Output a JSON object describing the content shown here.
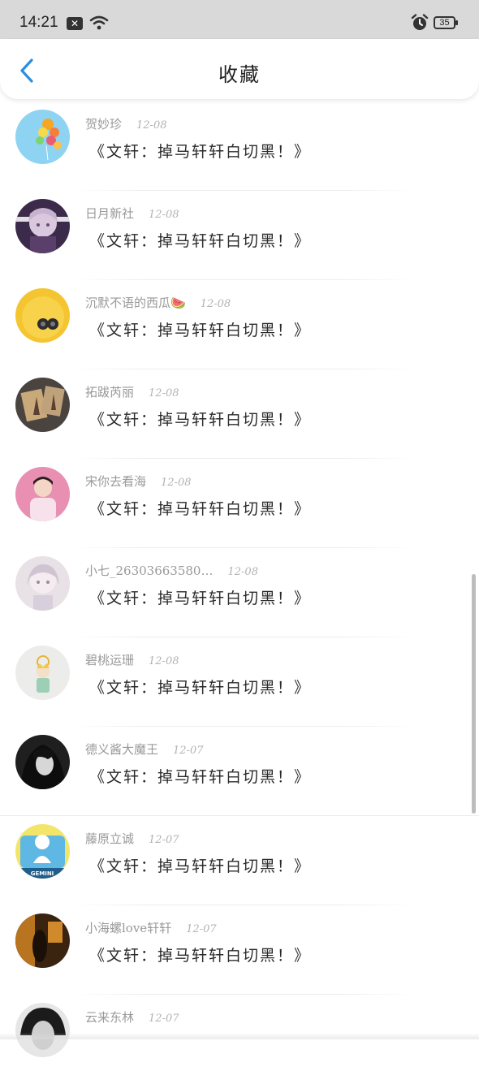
{
  "status_bar": {
    "time": "14:21",
    "notification_glyph": "✕",
    "battery": "35",
    "icons": [
      "notification-icon",
      "wifi-icon",
      "alarm-icon",
      "battery-icon"
    ]
  },
  "header": {
    "title": "收藏",
    "back_icon": "chevron-left-icon",
    "accent_color": "#2a8fe0"
  },
  "items": [
    {
      "name": "贺妙珍",
      "date": "12-08",
      "message": "《文轩：掉马轩轩白切黑！》"
    },
    {
      "name": "日月新社",
      "date": "12-08",
      "message": "《文轩：掉马轩轩白切黑！》"
    },
    {
      "name": "沉默不语的西瓜🍉",
      "date": "12-08",
      "message": "《文轩：掉马轩轩白切黑！》"
    },
    {
      "name": "拓跋芮丽",
      "date": "12-08",
      "message": "《文轩：掉马轩轩白切黑！》"
    },
    {
      "name": "宋你去看海",
      "date": "12-08",
      "message": "《文轩：掉马轩轩白切黑！》"
    },
    {
      "name": "小七_26303663580…",
      "date": "12-08",
      "message": "《文轩：掉马轩轩白切黑！》"
    },
    {
      "name": "碧桃运珊",
      "date": "12-08",
      "message": "《文轩：掉马轩轩白切黑！》"
    },
    {
      "name": "德义酱大魔王",
      "date": "12-07",
      "message": "《文轩：掉马轩轩白切黑！》"
    },
    {
      "name": "藤原立诚",
      "date": "12-07",
      "message": "《文轩：掉马轩轩白切黑！》"
    },
    {
      "name": "小海螺love轩轩",
      "date": "12-07",
      "message": "《文轩：掉马轩轩白切黑！》"
    },
    {
      "name": "云来东林",
      "date": "12-07",
      "message": ""
    }
  ],
  "avatar_image_text": "GEMINI"
}
